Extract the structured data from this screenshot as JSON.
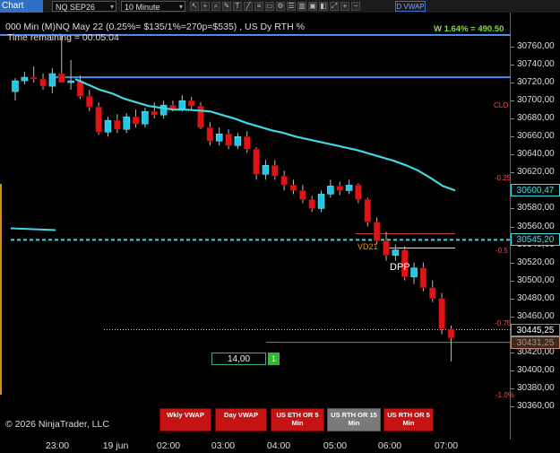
{
  "toolbar": {
    "chart_label": "Chart",
    "instrument": "NQ SEP26",
    "interval": "10 Minute",
    "vwap_button": "D VWAP",
    "tool_icons": [
      "cursor-icon",
      "crosshair-icon",
      "zoom-icon",
      "pencil-icon",
      "text-icon",
      "line-icon",
      "fib-icon",
      "rect-icon",
      "gear-icon",
      "list-icon",
      "chart-icon",
      "save-icon",
      "template-icon",
      "expand-icon",
      "plus-icon",
      "minus-icon"
    ]
  },
  "info": {
    "line1": "000 Min (M)NQ May 22 (0.25%= $135/1%=270p=$535) , US Dy RTH %",
    "line2": "Time remaining = 00:05:04",
    "w_text": "W 1.64% = 490.50",
    "copyright": "© 2026 NinjaTrader, LLC"
  },
  "pct_labels": {
    "clo": "CLO",
    "p025": "-0.25",
    "p05": "-0.5",
    "p075": "-0.75",
    "p10": "-1.0%"
  },
  "annotations": {
    "dpp": "DPP",
    "vwap_mark": "VD21"
  },
  "order": {
    "quantity": "14,00",
    "count": "1"
  },
  "vwap_buttons": [
    "Wkly VWAP",
    "Day VWAP",
    "US ETH OR 5 Min",
    "US RTH OR 15 Min",
    "US RTH OR 5 Min"
  ],
  "y_axis": {
    "ticks": [
      "30760,00",
      "30740,00",
      "30720,00",
      "30700,00",
      "30680,00",
      "30660,00",
      "30640,00",
      "30620,00",
      "30600,00",
      "30580,00",
      "30560,00",
      "30540,00",
      "30520,00",
      "30500,00",
      "30480,00",
      "30460,00",
      "30440,00",
      "30420,00",
      "30400,00",
      "30380,00",
      "30360,00"
    ],
    "price_labels": [
      {
        "text": "30600,47",
        "color": "#43d8e0"
      },
      {
        "text": "30545,20",
        "color": "#43d8e0"
      },
      {
        "text": "30445,25",
        "color": "#ffffff"
      },
      {
        "text": "30431,25",
        "color": "#c88870"
      }
    ]
  },
  "x_axis": {
    "ticks": [
      "23:00",
      "19 jun",
      "02:00",
      "03:00",
      "04:00",
      "05:00",
      "06:00",
      "07:00"
    ]
  },
  "colors": {
    "bull": "#1ec8e8",
    "bear": "#e01414",
    "vwap": "#43d8e0",
    "level_line": "#4a8ee8",
    "accent_green": "#2fb82f"
  },
  "chart_data": {
    "type": "candlestick",
    "ylim": [
      30355,
      30775
    ],
    "candles": [
      {
        "o": 30710,
        "h": 30725,
        "l": 30700,
        "c": 30722
      },
      {
        "o": 30722,
        "h": 30732,
        "l": 30718,
        "c": 30726
      },
      {
        "o": 30726,
        "h": 30738,
        "l": 30720,
        "c": 30724
      },
      {
        "o": 30724,
        "h": 30730,
        "l": 30712,
        "c": 30716
      },
      {
        "o": 30716,
        "h": 30736,
        "l": 30708,
        "c": 30730
      },
      {
        "o": 30730,
        "h": 30772,
        "l": 30720,
        "c": 30720
      },
      {
        "o": 30720,
        "h": 30745,
        "l": 30712,
        "c": 30722
      },
      {
        "o": 30722,
        "h": 30728,
        "l": 30702,
        "c": 30705
      },
      {
        "o": 30705,
        "h": 30712,
        "l": 30688,
        "c": 30693
      },
      {
        "o": 30693,
        "h": 30698,
        "l": 30662,
        "c": 30665
      },
      {
        "o": 30665,
        "h": 30682,
        "l": 30660,
        "c": 30678
      },
      {
        "o": 30678,
        "h": 30685,
        "l": 30664,
        "c": 30668
      },
      {
        "o": 30668,
        "h": 30686,
        "l": 30664,
        "c": 30682
      },
      {
        "o": 30682,
        "h": 30690,
        "l": 30670,
        "c": 30674
      },
      {
        "o": 30674,
        "h": 30692,
        "l": 30670,
        "c": 30688
      },
      {
        "o": 30688,
        "h": 30698,
        "l": 30680,
        "c": 30684
      },
      {
        "o": 30684,
        "h": 30700,
        "l": 30680,
        "c": 30695
      },
      {
        "o": 30695,
        "h": 30700,
        "l": 30688,
        "c": 30691
      },
      {
        "o": 30691,
        "h": 30706,
        "l": 30688,
        "c": 30700
      },
      {
        "o": 30700,
        "h": 30704,
        "l": 30690,
        "c": 30694
      },
      {
        "o": 30694,
        "h": 30698,
        "l": 30668,
        "c": 30670
      },
      {
        "o": 30670,
        "h": 30676,
        "l": 30650,
        "c": 30655
      },
      {
        "o": 30655,
        "h": 30670,
        "l": 30650,
        "c": 30663
      },
      {
        "o": 30663,
        "h": 30668,
        "l": 30646,
        "c": 30650
      },
      {
        "o": 30650,
        "h": 30664,
        "l": 30646,
        "c": 30660
      },
      {
        "o": 30660,
        "h": 30666,
        "l": 30642,
        "c": 30646
      },
      {
        "o": 30646,
        "h": 30648,
        "l": 30612,
        "c": 30618
      },
      {
        "o": 30618,
        "h": 30634,
        "l": 30612,
        "c": 30628
      },
      {
        "o": 30628,
        "h": 30634,
        "l": 30612,
        "c": 30616
      },
      {
        "o": 30616,
        "h": 30622,
        "l": 30600,
        "c": 30606
      },
      {
        "o": 30606,
        "h": 30612,
        "l": 30596,
        "c": 30600
      },
      {
        "o": 30600,
        "h": 30606,
        "l": 30586,
        "c": 30590
      },
      {
        "o": 30590,
        "h": 30594,
        "l": 30576,
        "c": 30580
      },
      {
        "o": 30580,
        "h": 30600,
        "l": 30576,
        "c": 30596
      },
      {
        "o": 30596,
        "h": 30612,
        "l": 30592,
        "c": 30605
      },
      {
        "o": 30605,
        "h": 30610,
        "l": 30595,
        "c": 30600
      },
      {
        "o": 30600,
        "h": 30612,
        "l": 30596,
        "c": 30606
      },
      {
        "o": 30606,
        "h": 30608,
        "l": 30586,
        "c": 30590
      },
      {
        "o": 30590,
        "h": 30592,
        "l": 30560,
        "c": 30565
      },
      {
        "o": 30565,
        "h": 30570,
        "l": 30540,
        "c": 30544
      },
      {
        "o": 30544,
        "h": 30554,
        "l": 30522,
        "c": 30528
      },
      {
        "o": 30528,
        "h": 30540,
        "l": 30522,
        "c": 30534
      },
      {
        "o": 30534,
        "h": 30538,
        "l": 30500,
        "c": 30504
      },
      {
        "o": 30504,
        "h": 30520,
        "l": 30496,
        "c": 30514
      },
      {
        "o": 30514,
        "h": 30520,
        "l": 30488,
        "c": 30492
      },
      {
        "o": 30492,
        "h": 30500,
        "l": 30476,
        "c": 30480
      },
      {
        "o": 30480,
        "h": 30486,
        "l": 30440,
        "c": 30446
      },
      {
        "o": 30446,
        "h": 30450,
        "l": 30410,
        "c": 30436
      }
    ],
    "vwap_line": [
      30724,
      30718,
      30712,
      30708,
      30702,
      30698,
      30694,
      30692,
      30690,
      30690,
      30689,
      30688,
      30684,
      30680,
      30675,
      30671,
      30667,
      30664,
      30660,
      30657,
      30654,
      30651,
      30648,
      30645,
      30641,
      30637,
      30633,
      30628,
      30622,
      30614,
      30605,
      30600
    ],
    "levels": [
      {
        "price": 30773,
        "label": "upper-level"
      },
      {
        "price": 30726,
        "label": "mid-level"
      },
      {
        "price": 30545.2,
        "label": "vwap-dashed"
      },
      {
        "price": 30445.25,
        "label": "last-price"
      },
      {
        "price": 30431.25,
        "label": "order-line"
      }
    ]
  }
}
